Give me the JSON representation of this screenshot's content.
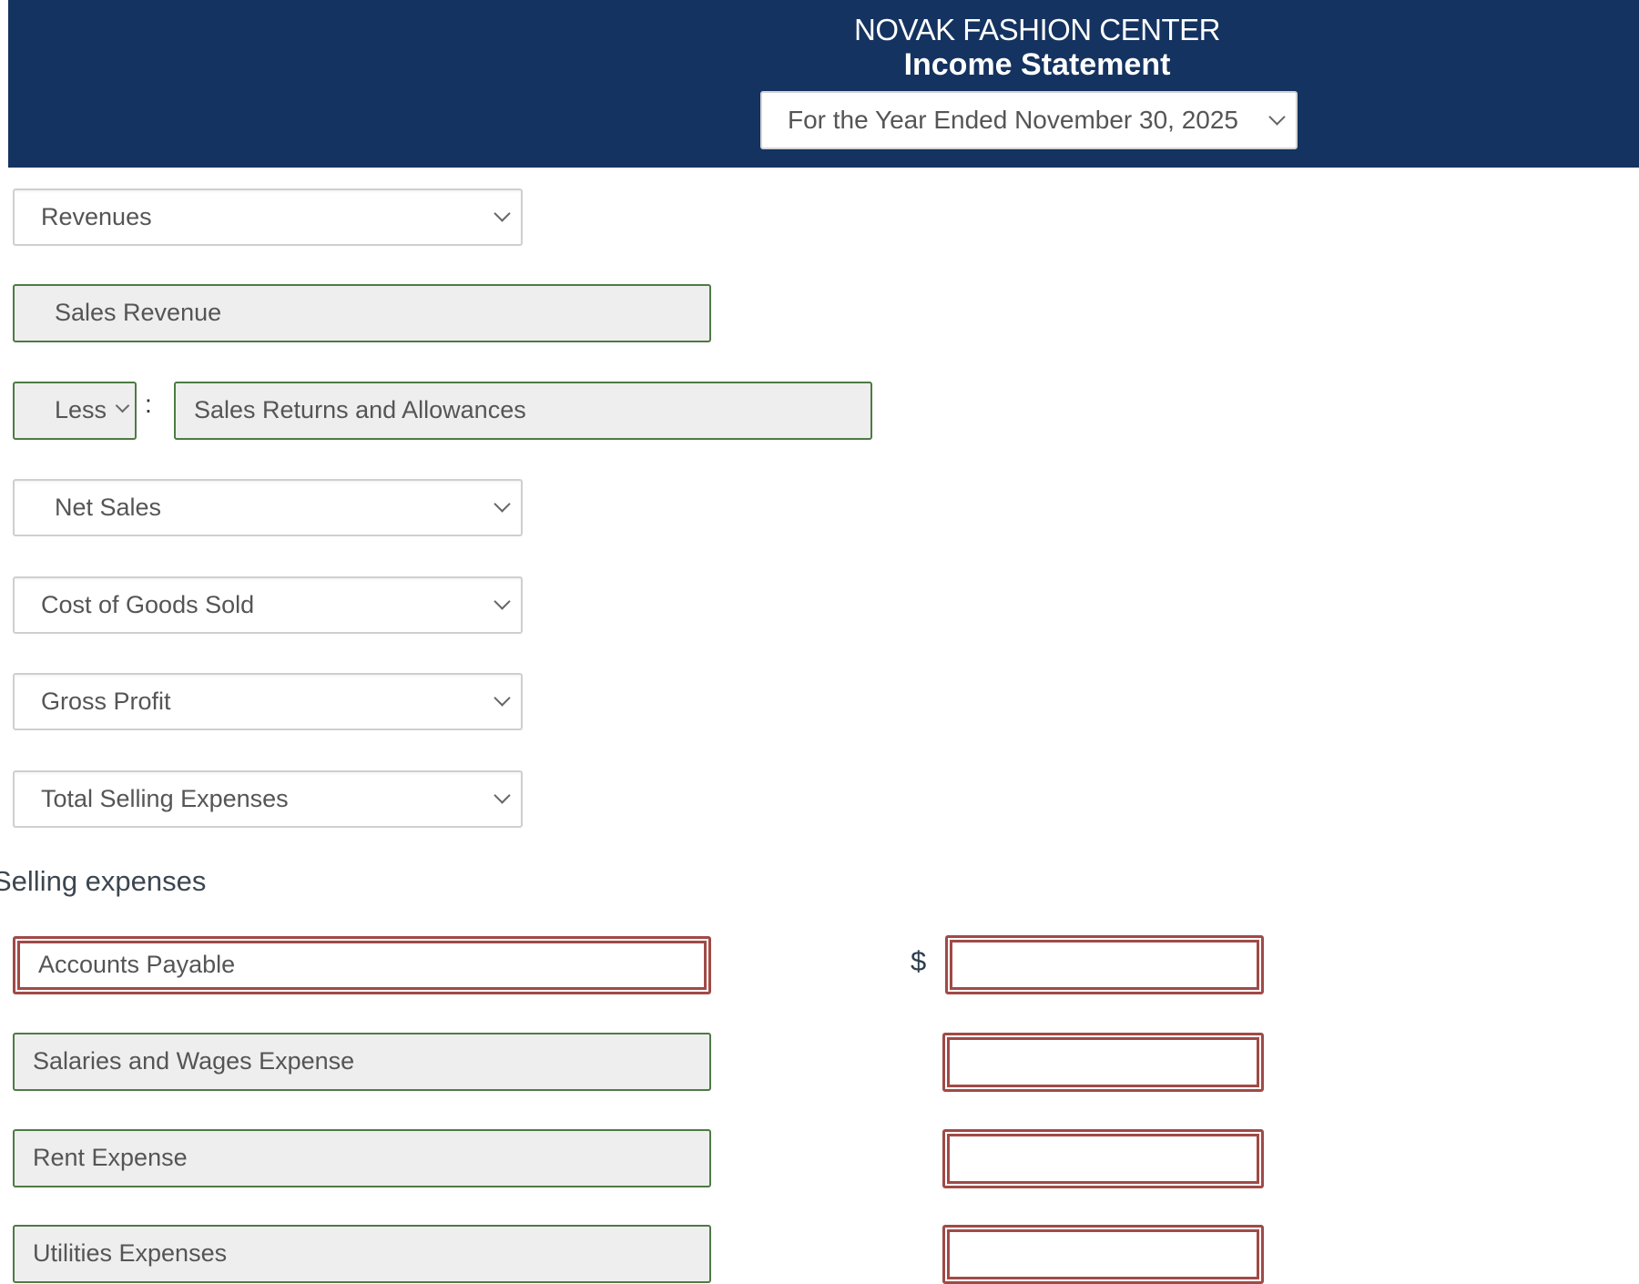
{
  "header": {
    "company": "NOVAK FASHION CENTER",
    "statement": "Income Statement",
    "period_select": {
      "value": "For the Year Ended November 30, 2025"
    }
  },
  "rows": {
    "revenues_select": {
      "value": "Revenues"
    },
    "sales_revenue_field": {
      "value": "Sales Revenue"
    },
    "less_select": {
      "value": "Less"
    },
    "colon": ":",
    "sales_returns_field": {
      "value": "Sales Returns and Allowances"
    },
    "net_sales_select": {
      "value": "Net Sales"
    },
    "cogs_select": {
      "value": "Cost of Goods Sold"
    },
    "gross_profit_select": {
      "value": "Gross Profit"
    },
    "total_selling_select": {
      "value": "Total Selling Expenses"
    }
  },
  "selling_expenses": {
    "label": "Selling expenses",
    "currency_symbol": "$",
    "items": [
      {
        "account": "Accounts Payable",
        "amount": "",
        "account_status": "incorrect",
        "amount_status": "incorrect"
      },
      {
        "account": "Salaries and Wages Expense",
        "amount": "",
        "account_status": "correct",
        "amount_status": "incorrect"
      },
      {
        "account": "Rent Expense",
        "amount": "",
        "account_status": "correct",
        "amount_status": "incorrect"
      },
      {
        "account": "Utilities Expenses",
        "amount": "",
        "account_status": "correct",
        "amount_status": "incorrect"
      }
    ]
  },
  "colors": {
    "header_bg": "#143360",
    "correct_border": "#4e7a45",
    "incorrect_border": "#a04a47"
  }
}
